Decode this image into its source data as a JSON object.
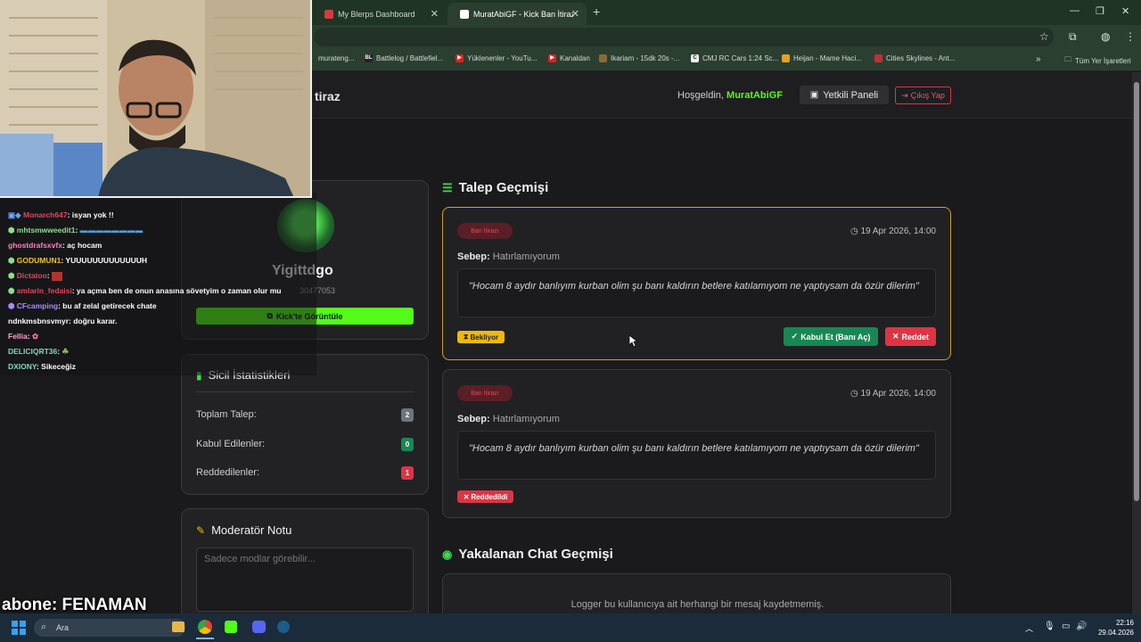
{
  "browser": {
    "tabs": [
      {
        "title": "My Blerps Dashboard"
      },
      {
        "title": "MuratAbiGF - Kick Ban İtiraz Si..."
      }
    ],
    "bookmarks": [
      "murateng...",
      "Battlelog / Battlefiel...",
      "Yüklenenler - YouTu...",
      "Kanaldan",
      "Ikariam - 15dk 20s -...",
      "CMJ RC Cars 1:24 Sc...",
      "Heijan - Mame Haci...",
      "Cities Skylines - Ant..."
    ],
    "all_bookmarks": "Tüm Yer İşaretleri",
    "more_bookmarks": "»"
  },
  "header": {
    "title_fragment": "tiraz",
    "welcome_prefix": "Hoşgeldin,",
    "username": "MuratAbiGF",
    "panel_button": "Yetkili Paneli",
    "logout_button": "Çıkış Yap"
  },
  "profile": {
    "name": "Yigittdgo",
    "id_fragment": "30477053",
    "view_button": "Kick'te Görüntüle"
  },
  "stats": {
    "title": "Sicil İstatistikleri",
    "rows": [
      {
        "label": "Toplam Talep:",
        "value": "2",
        "color": "#6c757d"
      },
      {
        "label": "Kabul Edilenler:",
        "value": "0",
        "color": "#198754"
      },
      {
        "label": "Reddedilenler:",
        "value": "1",
        "color": "#dc3545"
      }
    ]
  },
  "mod_note": {
    "title": "Moderatör Notu",
    "placeholder": "Sadece modlar görebilir..."
  },
  "history": {
    "title": "Talep Geçmişi",
    "requests": [
      {
        "type": "Ban İtirazı",
        "date": "19 Apr 2026, 14:00",
        "reason_label": "Sebep:",
        "reason": "Hatırlamıyorum",
        "message": "\"Hocam 8 aydır banlıyım kurban olim şu banı kaldırın betlere katılamıyom ne yaptıysam da özür dilerim\"",
        "status": "Bekliyor",
        "accept_label": "Kabul Et (Banı Aç)",
        "reject_label": "Reddet"
      },
      {
        "type": "Ban İtirazı",
        "date": "19 Apr 2026, 14:00",
        "reason_label": "Sebep:",
        "reason": "Hatırlamıyorum",
        "message": "\"Hocam 8 aydır banlıyım kurban olim şu banı kaldırın betlere katılamıyom ne yaptıysam da özür dilerim\"",
        "status": "Reddedildi"
      }
    ]
  },
  "chat_history": {
    "title": "Yakalanan Chat Geçmişi",
    "empty": "Logger bu kullanıcıya ait herhangi bir mesaj kaydetmemiş."
  },
  "stream_chat": [
    {
      "user": "Monarch647",
      "color": "#e0475b",
      "msg": ": isyan yok !!"
    },
    {
      "user": "mhtsmwweedit1",
      "color": "#8be08b",
      "msg": ":"
    },
    {
      "user": "ghostdrafsxvfx",
      "color": "#ff7fbf",
      "msg": ": aç hocam"
    },
    {
      "user": "GODUMUN1",
      "color": "#f5c518",
      "msg": ": YUUUUUUUUUUUUUH"
    },
    {
      "user": "Dictatoo",
      "color": "#e0475b",
      "msg": ":"
    },
    {
      "user": "amlarin_fedaisi",
      "color": "#e0475b",
      "msg": ": ya açma ben de onun anasına sövetyim o zaman olur mu"
    },
    {
      "user": "CFcamping",
      "color": "#a98bff",
      "msg": ": bu af zelal getirecek chate"
    },
    {
      "user": "ndnkmsbnsvmyr",
      "color": "#ffffff",
      "msg": ": doğru karar."
    },
    {
      "user": "Fellia",
      "color": "#ff9fd0",
      "msg": ":"
    },
    {
      "user": "DELICIQRT36",
      "color": "#7fd6c0",
      "msg": ":"
    },
    {
      "user": "DXIONY",
      "color": "#7fd6c0",
      "msg": ": Sikeceğiz"
    }
  ],
  "overlay": {
    "text": "abone: FENAMAN"
  },
  "taskbar": {
    "search": "Ara",
    "time": "22:16",
    "date": "29.04.2026"
  }
}
